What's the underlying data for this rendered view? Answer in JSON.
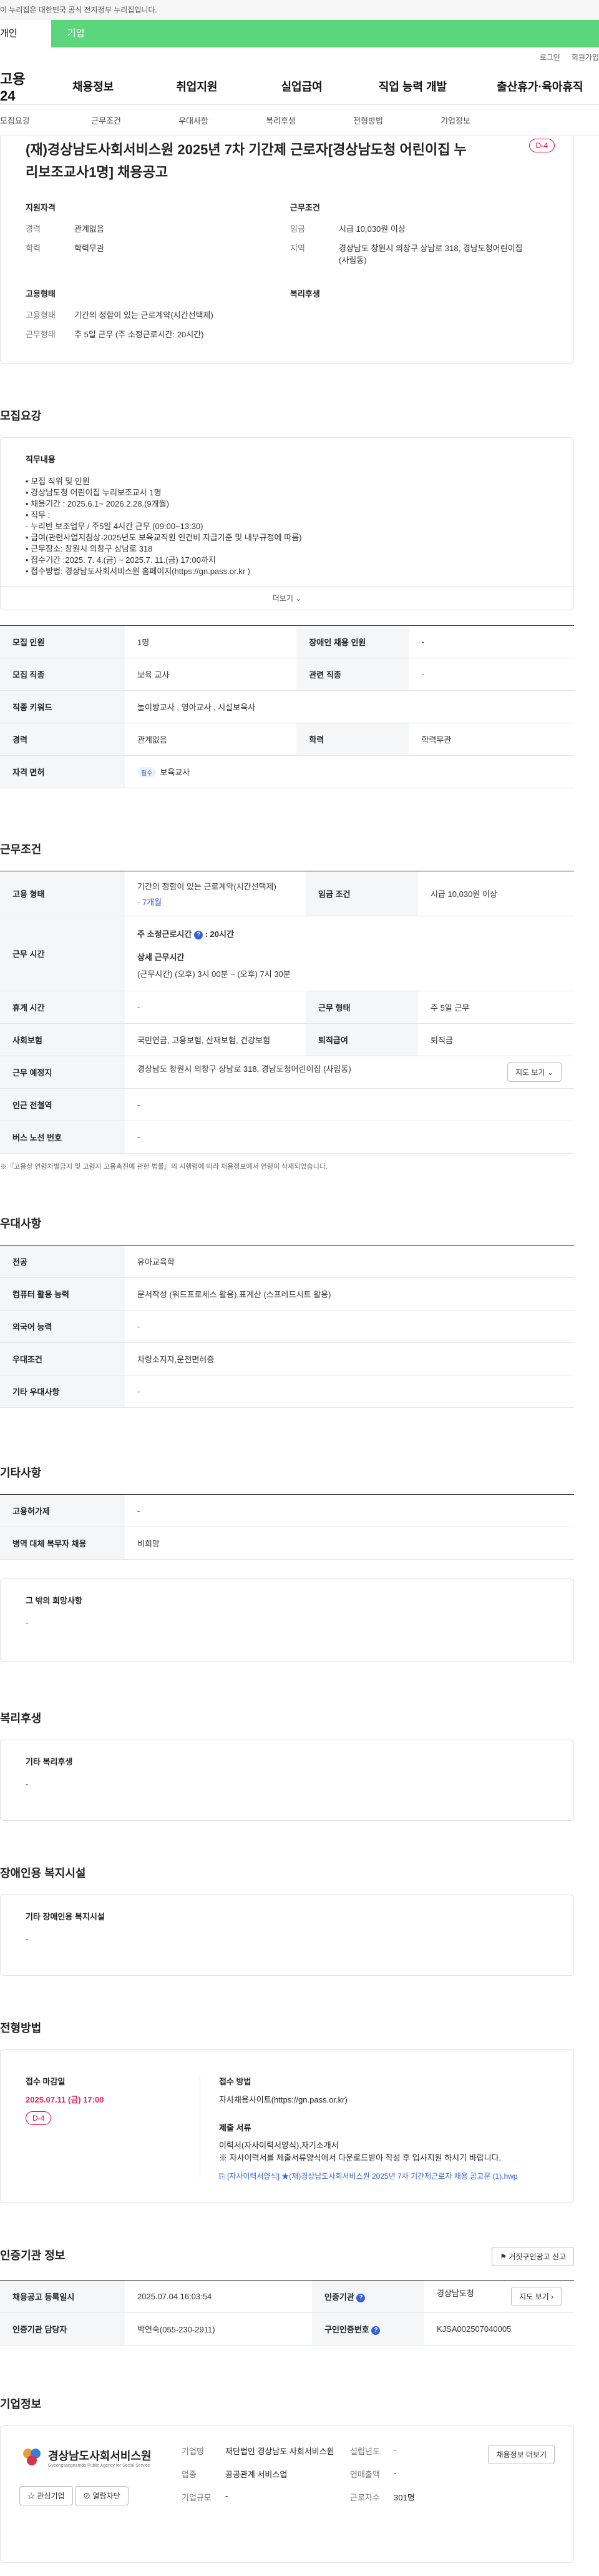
{
  "gov_banner": "이 누리집은 대한민국 공식 전자정부 누리집입니다.",
  "tabs": [
    "개인",
    "기업"
  ],
  "util": [
    "로그인",
    "회원가입"
  ],
  "logo": "고용24",
  "gnb": [
    "채용정보",
    "취업지원",
    "실업급여",
    "직업 능력 개발",
    "출산휴가·육아휴직"
  ],
  "anchors": [
    "모집요강",
    "근무조건",
    "우대사항",
    "복리후생",
    "전형방법",
    "기업정보"
  ],
  "header": {
    "title": "(재)경상남도사회서비스원 2025년 7차 기간제 근로자[경상남도청 어린이집 누리보조교사1명] 채용공고",
    "dday": "D-4",
    "qual_title": "지원자격",
    "qual": [
      [
        "경력",
        "관계없음"
      ],
      [
        "학력",
        "학력무관"
      ]
    ],
    "cond_title": "근무조건",
    "cond": [
      [
        "임금",
        "시급 10,030원 이상"
      ],
      [
        "지역",
        "경상남도 창원시 의창구 상남로 318, 경남도청어린이집(사림동)"
      ]
    ],
    "emp_title": "고용형태",
    "emp": [
      [
        "고용형태",
        "기간의 정함이 있는 근로계약(시간선택제)"
      ],
      [
        "근무형태",
        "주 5일 근무 (주 소정근로시간: 20시간)"
      ]
    ],
    "welfare_title": "복리후생"
  },
  "recruit": {
    "title": "모집요강",
    "box_title": "직무내용",
    "lines": [
      "• 모집 직위 및 인원",
      "• 경상남도청 어린이집 누리보조교사 1명",
      "• 채용기간 : 2025.6.1~ 2026.2.28.(9개월)",
      "• 직무 :",
      "- 누리반 보조업무 / 주5일 4시간 근무 (09:00~13:30)",
      "• 급여(관련사업지침상-2025년도 보육교직원  인건비 지급기준 및 내부규정에 따름)",
      "• 근무장소: 창원시 의창구 상남로 318",
      "• 접수기간 :2025. 7. 4.(금) ~ 2025.7. 11.(금) 17:00까지",
      "• 접수방법: 경상남도사회서비스원 홈페이지(https://gn.pass.or.kr )"
    ],
    "more": "더보기",
    "rows": [
      [
        "모집 인원",
        "1명",
        "장애인 채용 인원",
        "-"
      ],
      [
        "모집 직종",
        "보육 교사",
        "관련 직종",
        "-"
      ],
      [
        "직종 키워드",
        "놀이방교사 , 영아교사 , 시설보육사"
      ],
      [
        "경력",
        "관계없음",
        "학력",
        "학력무관"
      ],
      [
        "자격 면허",
        "필수",
        "보육교사"
      ]
    ]
  },
  "work": {
    "title": "근무조건",
    "emp_label": "고용 형태",
    "emp_value": "기간의 정함이 있는 근로계약(시간선택제)",
    "emp_sub": "- 7개월",
    "pay_label": "임금 조건",
    "pay_value": "시급 10,030원 이상",
    "time_label": "근무 시간",
    "time1": "주 소정근로시간",
    "time1b": "20시간",
    "time2": "상세 근무시간",
    "time3": "(근무시간) (오후) 3시 00분 ~ (오후) 7시 30분",
    "rows": [
      [
        "휴게 시간",
        "-",
        "근무 형태",
        "주 5일 근무"
      ],
      [
        "사회보험",
        "국민연금, 고용보험, 산재보험, 건강보험",
        "퇴직급여",
        "퇴직금"
      ]
    ],
    "place_label": "근무 예정지",
    "place_value": "경상남도 창원시 의창구 상남로 318, 경남도청어린이집 (사림동)",
    "map_btn": "지도 보기",
    "rows2": [
      [
        "인근 전철역",
        "-"
      ],
      [
        "버스 노선 번호",
        "-"
      ]
    ],
    "note": "※『고용상 연령차별금지 및 고령자 고용촉진에 관한 법률』의 시행령에 따라 채용정보에서 연령이 삭제되었습니다."
  },
  "prefer": {
    "title": "우대사항",
    "rows": [
      [
        "전공",
        "유아교육학"
      ],
      [
        "컴퓨터 활용 능력",
        "문서작성 (워드프로세스 활용),표계산 (스프레드시트 활용)"
      ],
      [
        "외국어 능력",
        "-"
      ],
      [
        "우대조건",
        "차량소지자,운전면허증"
      ],
      [
        "기타 우대사항",
        "-"
      ]
    ]
  },
  "etc": {
    "title": "기타사항",
    "rows": [
      [
        "고용허가제",
        "-"
      ],
      [
        "병역 대체 복무자 채용",
        "비희망"
      ]
    ],
    "box_title": "그 밖의 희망사항",
    "box_val": "-"
  },
  "welfare": {
    "title": "복리후생",
    "box_title": "기타 복리후생",
    "box_val": "-"
  },
  "disability": {
    "title": "장애인용 복지시설",
    "box_title": "기타 장애인용 복지시설",
    "box_val": "-"
  },
  "screening": {
    "title": "전형방법",
    "deadline_label": "접수 마감일",
    "deadline": "2025.07.11 (금) 17:00",
    "dday": "D-4",
    "method_label": "접수 방법",
    "method": "자사채용사이트(https://gn.pass.or.kr)",
    "docs_label": "제출 서류",
    "docs1": "이력서(자사이력서양식),자기소개서",
    "docs2": "※ 자사이력서를 제출서류양식에서 다운로드받아 작성 후 입사지원 하시기 바랍니다.",
    "file": "[자사이력서양식] ★(재)경상남도사회서비스원 2025년 7차 기간제근로자 채용 공고문 (1).hwp"
  },
  "agency": {
    "title": "인증기관 정보",
    "report_btn": "거짓구인광고 신고",
    "rows": [
      [
        "채용공고 등록일시",
        "2025.07.04 16:03:54",
        "인증기관",
        "경상남도청"
      ],
      [
        "인증기관 담당자",
        "박연숙(055-230-2911)",
        "구인인증번호",
        "KJSA002507040005"
      ]
    ],
    "map_btn": "지도 보기"
  },
  "company": {
    "title": "기업정보",
    "logo_text": "경상남도사회서비스원",
    "logo_sub": "Gyeongsangnamdo Public Agency for Social Service",
    "fav_btn": "관심기업",
    "block_btn": "열람차단",
    "jobs_btn": "채용정보 더보기",
    "rows": [
      [
        "기업명",
        "재단법인 경상남도 사회서비스원",
        "설립년도",
        "-"
      ],
      [
        "업종",
        "공공관계 서비스업",
        "연매출액",
        "-"
      ],
      [
        "기업규모",
        "-",
        "근로자수",
        "301명"
      ]
    ]
  }
}
